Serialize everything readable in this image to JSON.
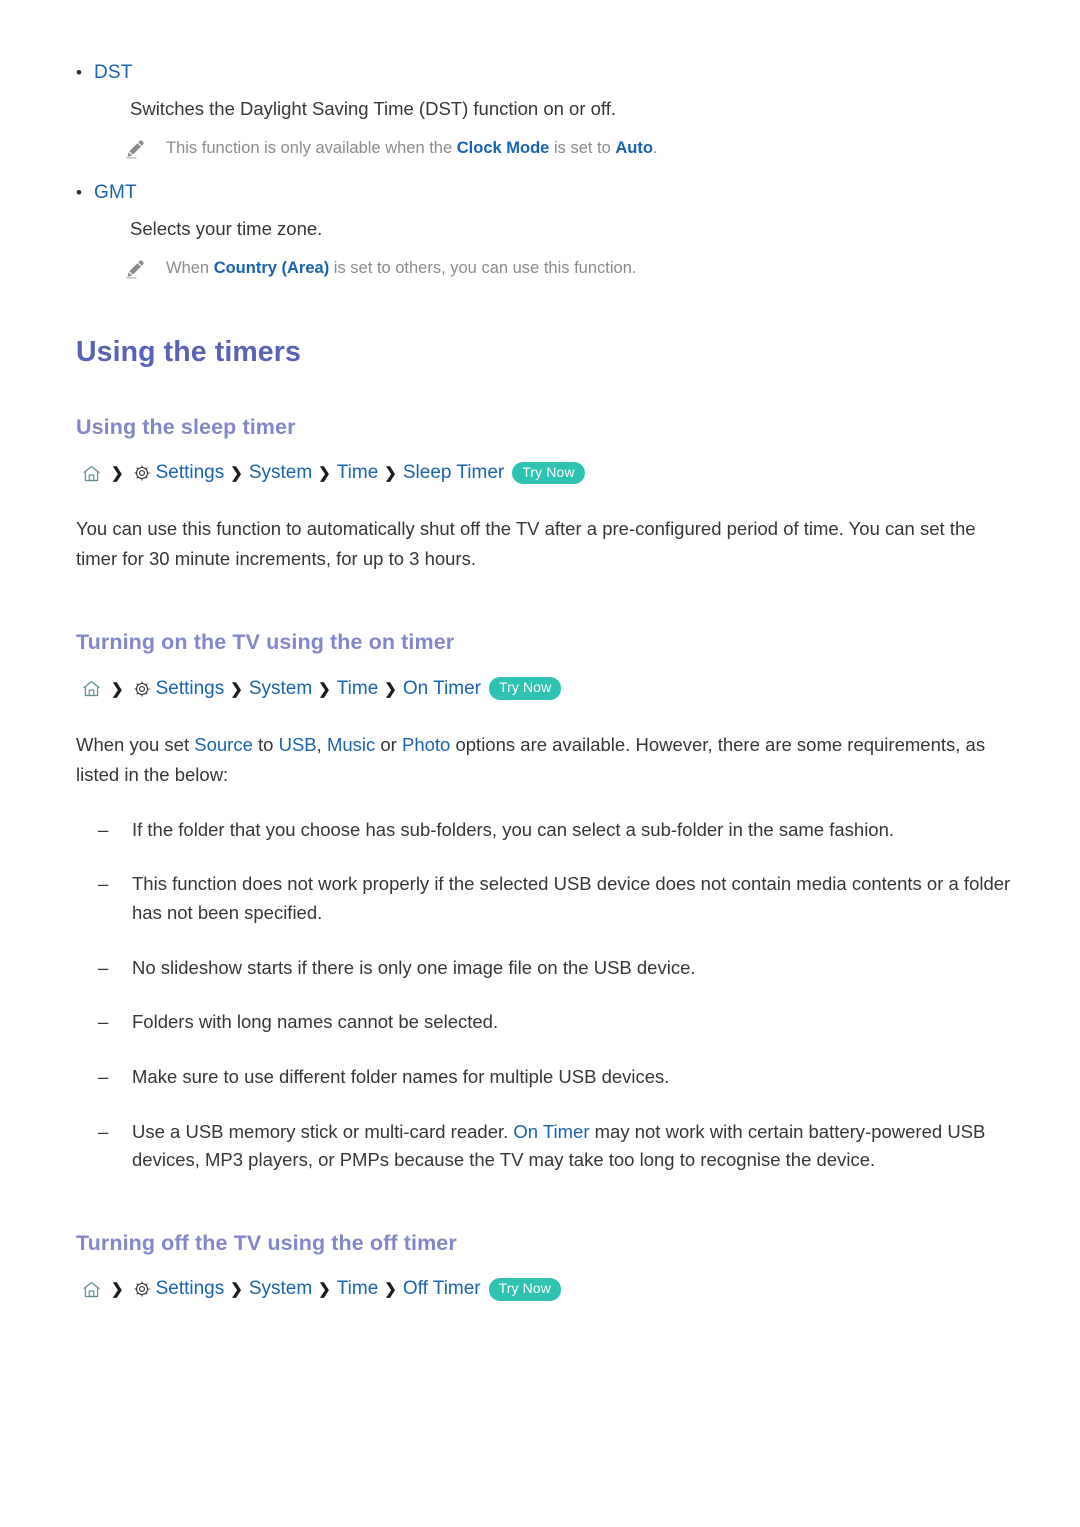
{
  "options": [
    {
      "name": "DST",
      "description": "Switches the Daylight Saving Time (DST) function on or off.",
      "note": {
        "before": "This function is only available when the ",
        "link1": "Clock Mode",
        "middle": " is set to ",
        "link2": "Auto",
        "after": "."
      }
    },
    {
      "name": "GMT",
      "description": "Selects your time zone.",
      "note": {
        "before": "When ",
        "link1": "Country (Area)",
        "middle": " is set to others, you can use this function.",
        "link2": "",
        "after": ""
      }
    }
  ],
  "page_title": "Using the timers",
  "sections": [
    {
      "heading": "Using the sleep timer",
      "breadcrumb": {
        "home_icon": "home-icon",
        "gear_icon": "gear-icon",
        "items": [
          "Settings",
          "System",
          "Time",
          "Sleep Timer"
        ],
        "separator": "❯",
        "badge": "Try Now"
      },
      "paragraph": "You can use this function to automatically shut off the TV after a pre-configured period of time. You can set the timer for 30 minute increments, for up to 3 hours."
    },
    {
      "heading": "Turning on the TV using the on timer",
      "breadcrumb": {
        "home_icon": "home-icon",
        "gear_icon": "gear-icon",
        "items": [
          "Settings",
          "System",
          "Time",
          "On Timer"
        ],
        "separator": "❯",
        "badge": "Try Now"
      },
      "paragraph_parts": {
        "p1": "When you set ",
        "l1": "Source",
        "p2": " to ",
        "l2": "USB",
        "p3": ", ",
        "l3": "Music",
        "p4": " or ",
        "l4": "Photo",
        "p5": " options are available. However, there are some requirements, as listed in the below:"
      },
      "bullets": [
        {
          "text": "If the folder that you choose has sub-folders, you can select a sub-folder in the same fashion."
        },
        {
          "text": "This function does not work properly if the selected USB device does not contain media contents or a folder has not been specified."
        },
        {
          "text": "No slideshow starts if there is only one image file on the USB device."
        },
        {
          "text": "Folders with long names cannot be selected."
        },
        {
          "text": "Make sure to use different folder names for multiple USB devices."
        },
        {
          "pre": "Use a USB memory stick or multi-card reader. ",
          "link": "On Timer",
          "post": " may not work with certain battery-powered USB devices, MP3 players, or PMPs because the TV may take too long to recognise the device."
        }
      ]
    },
    {
      "heading": "Turning off the TV using the off timer",
      "breadcrumb": {
        "home_icon": "home-icon",
        "gear_icon": "gear-icon",
        "items": [
          "Settings",
          "System",
          "Time",
          "Off Timer"
        ],
        "separator": "❯",
        "badge": "Try Now"
      }
    }
  ],
  "colors": {
    "link_blue": "#1a63ae",
    "title_indigo": "#5a62b5",
    "subtitle_periwinkle": "#8287c9",
    "badge_teal": "#2ec2b3",
    "note_gray": "#8b8b8b",
    "body_text": "#33373a",
    "home_icon_teal": "#5f8f92"
  }
}
